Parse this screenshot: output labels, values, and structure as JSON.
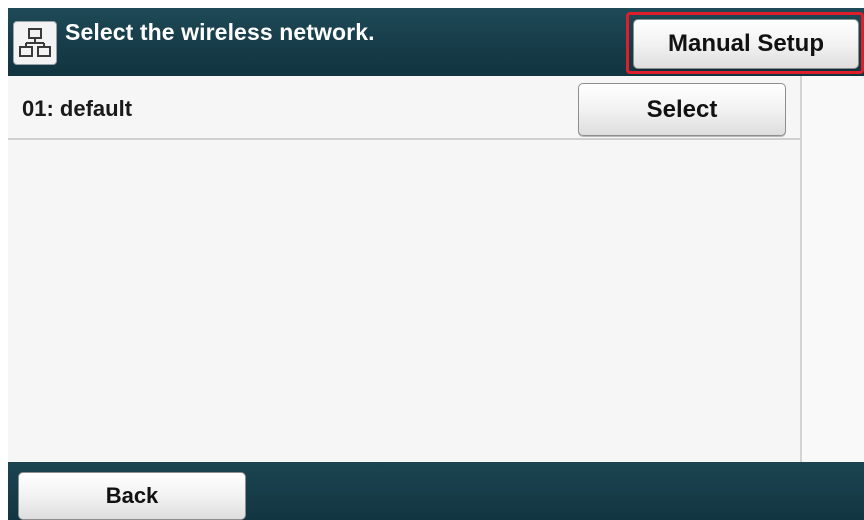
{
  "header": {
    "title": "Select the wireless network.",
    "icon": "network-icon",
    "manual_setup_label": "Manual Setup"
  },
  "list": {
    "items": [
      {
        "label": "01: default",
        "action_label": "Select"
      }
    ]
  },
  "footer": {
    "back_label": "Back"
  },
  "colors": {
    "header_bg": "#163c48",
    "highlight": "#e01d2a"
  }
}
